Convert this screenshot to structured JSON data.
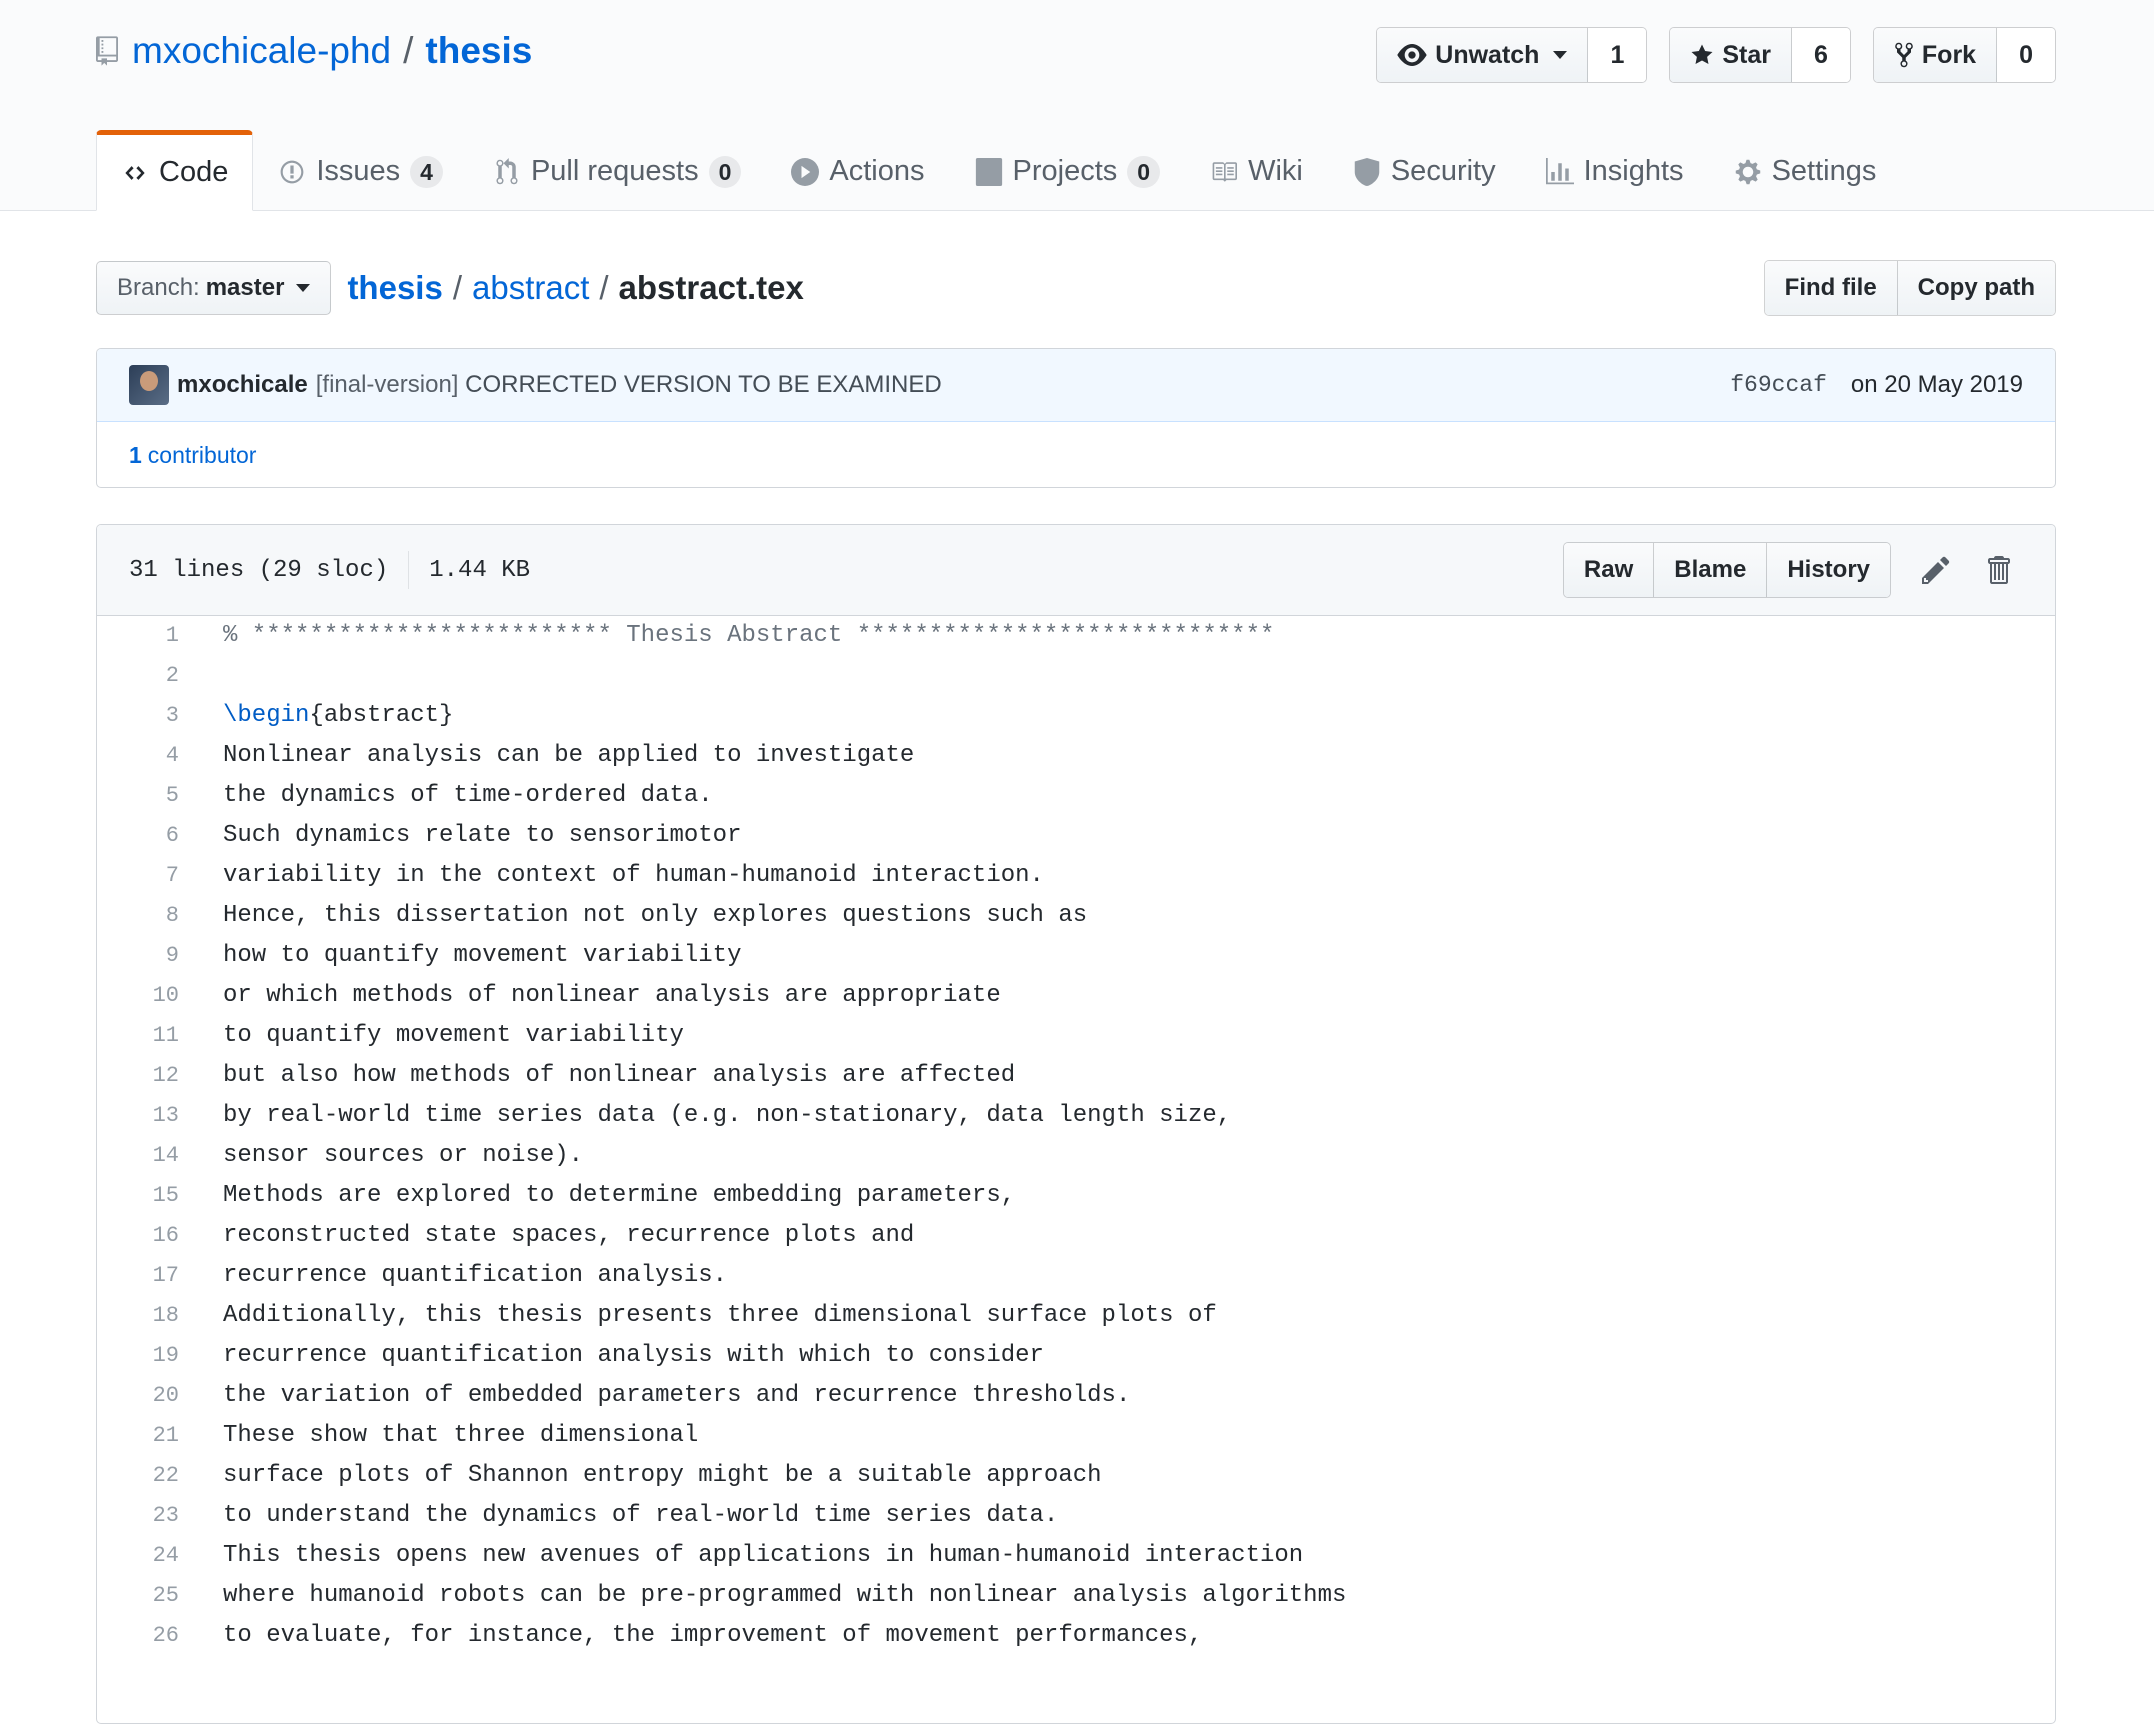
{
  "repo": {
    "owner": "mxochicale-phd",
    "separator": "/",
    "name": "thesis"
  },
  "actions": {
    "watch": {
      "label": "Unwatch",
      "count": "1"
    },
    "star": {
      "label": "Star",
      "count": "6"
    },
    "fork": {
      "label": "Fork",
      "count": "0"
    }
  },
  "nav": [
    {
      "label": "Code",
      "icon": "code-icon",
      "counter": null,
      "selected": true
    },
    {
      "label": "Issues",
      "icon": "issue-icon",
      "counter": "4"
    },
    {
      "label": "Pull requests",
      "icon": "pull-request-icon",
      "counter": "0"
    },
    {
      "label": "Actions",
      "icon": "play-icon",
      "counter": null
    },
    {
      "label": "Projects",
      "icon": "project-icon",
      "counter": "0"
    },
    {
      "label": "Wiki",
      "icon": "book-icon",
      "counter": null
    },
    {
      "label": "Security",
      "icon": "shield-icon",
      "counter": null
    },
    {
      "label": "Insights",
      "icon": "graph-icon",
      "counter": null
    },
    {
      "label": "Settings",
      "icon": "gear-icon",
      "counter": null
    }
  ],
  "branch": {
    "prefix": "Branch:",
    "name": "master"
  },
  "breadcrumb": {
    "root": "thesis",
    "sep1": "/",
    "dir": "abstract",
    "sep2": "/",
    "file": "abstract.tex"
  },
  "file_buttons": {
    "find": "Find file",
    "copy": "Copy path"
  },
  "commit": {
    "author": "mxochicale",
    "tag": "[final-version]",
    "message": "CORRECTED VERSION TO BE EXAMINED",
    "sha": "f69ccaf",
    "date": "on 20 May 2019",
    "contributors_count": "1",
    "contributors_label": "contributor"
  },
  "file": {
    "lines_info": "31 lines (29 sloc)",
    "size": "1.44 KB",
    "buttons": {
      "raw": "Raw",
      "blame": "Blame",
      "history": "History"
    }
  },
  "code_lines": [
    "% ************************* Thesis Abstract *****************************",
    "",
    "\\begin{abstract}",
    "Nonlinear analysis can be applied to investigate",
    "the dynamics of time-ordered data.",
    "Such dynamics relate to sensorimotor",
    "variability in the context of human-humanoid interaction.",
    "Hence, this dissertation not only explores questions such as",
    "how to quantify movement variability",
    "or which methods of nonlinear analysis are appropriate",
    "to quantify movement variability",
    "but also how methods of nonlinear analysis are affected",
    "by real-world time series data (e.g. non-stationary, data length size,",
    "sensor sources or noise).",
    "Methods are explored to determine embedding parameters,",
    "reconstructed state spaces, recurrence plots and",
    "recurrence quantification analysis.",
    "Additionally, this thesis presents three dimensional surface plots of",
    "recurrence quantification analysis with which to consider",
    "the variation of embedded parameters and recurrence thresholds.",
    "These show that three dimensional",
    "surface plots of Shannon entropy might be a suitable approach",
    "to understand the dynamics of real-world time series data.",
    "This thesis opens new avenues of applications in human-humanoid interaction",
    "where humanoid robots can be pre-programmed with nonlinear analysis algorithms",
    "to evaluate, for instance, the improvement of movement performances,"
  ]
}
